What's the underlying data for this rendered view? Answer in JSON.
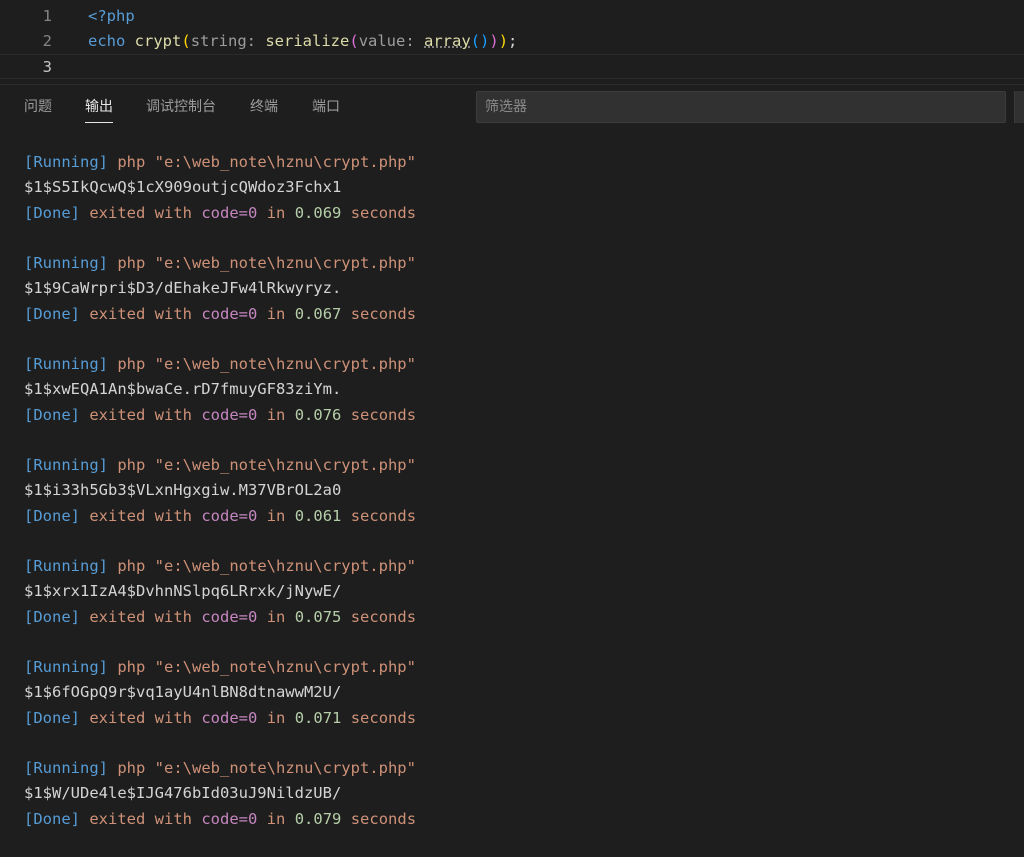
{
  "editor": {
    "lines": [
      {
        "number": "1",
        "tokens": [
          {
            "text": "<?php",
            "cls": "tk-kw"
          }
        ]
      },
      {
        "number": "2",
        "tokens": [
          {
            "text": "echo ",
            "cls": "tk-kw"
          },
          {
            "text": "crypt",
            "cls": "tk-fn"
          },
          {
            "text": "(",
            "cls": "tk-b1"
          },
          {
            "text": "string: ",
            "cls": "tk-param"
          },
          {
            "text": "serialize",
            "cls": "tk-fn"
          },
          {
            "text": "(",
            "cls": "tk-b2"
          },
          {
            "text": "value: ",
            "cls": "tk-param"
          },
          {
            "text": "array",
            "cls": "tk-fn squiggle"
          },
          {
            "text": "()",
            "cls": "tk-b3"
          },
          {
            "text": ")",
            "cls": "tk-b2"
          },
          {
            "text": ")",
            "cls": "tk-b1"
          },
          {
            "text": ";",
            "cls": "tk-plain"
          }
        ]
      },
      {
        "number": "3",
        "tokens": []
      }
    ]
  },
  "panel": {
    "tabs": [
      {
        "label": "问题",
        "active": false
      },
      {
        "label": "输出",
        "active": true
      },
      {
        "label": "调试控制台",
        "active": false
      },
      {
        "label": "终端",
        "active": false
      },
      {
        "label": "端口",
        "active": false
      }
    ],
    "filter_placeholder": "筛选器"
  },
  "output": {
    "running_tag": "[Running]",
    "command": "php \"e:\\web_note\\hznu\\crypt.php\"",
    "done_tag": "[Done]",
    "exited_text": "exited with",
    "code_text": "code=0",
    "in_text": "in",
    "seconds_text": "seconds",
    "runs": [
      {
        "hash": "$1$S5IkQcwQ$1cX909outjcQWdoz3Fchx1",
        "time": "0.069"
      },
      {
        "hash": "$1$9CaWrpri$D3/dEhakeJFw4lRkwyryz.",
        "time": "0.067"
      },
      {
        "hash": "$1$xwEQA1An$bwaCe.rD7fmuyGF83ziYm.",
        "time": "0.076"
      },
      {
        "hash": "$1$i33h5Gb3$VLxnHgxgiw.M37VBrOL2a0",
        "time": "0.061"
      },
      {
        "hash": "$1$xrx1IzA4$DvhnNSlpq6LRrxk/jNywE/",
        "time": "0.075"
      },
      {
        "hash": "$1$6fOGpQ9r$vq1ayU4nlBN8dtnawwM2U/",
        "time": "0.071"
      },
      {
        "hash": "$1$W/UDe4le$IJG476bId03uJ9NildzUB/",
        "time": "0.079"
      }
    ]
  }
}
